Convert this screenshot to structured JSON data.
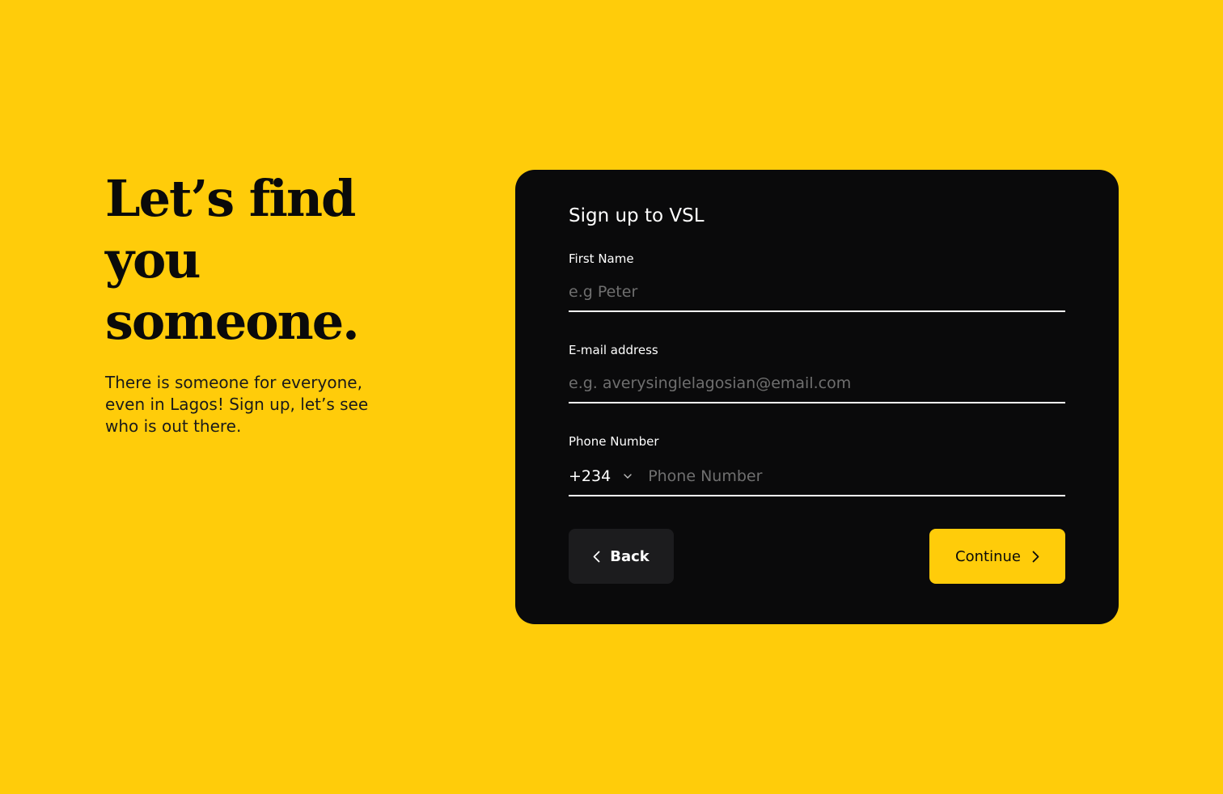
{
  "hero": {
    "title": "Let’s find you someone.",
    "subtitle": "There is someone for everyone, even in Lagos! Sign up, let’s see who is out there."
  },
  "form": {
    "title": "Sign up to VSL",
    "first_name": {
      "label": "First Name",
      "placeholder": "e.g Peter",
      "value": ""
    },
    "email": {
      "label": "E-mail address",
      "placeholder": "e.g. averysinglelagosian@email.com",
      "value": ""
    },
    "phone": {
      "label": "Phone Number",
      "country_code": "+234",
      "placeholder": "Phone Number",
      "value": ""
    },
    "back_label": "Back",
    "continue_label": "Continue"
  },
  "colors": {
    "background": "#FFCC0A",
    "card": "#0a0a0b",
    "accent": "#FFCC0A",
    "back_button": "#1c1c1e"
  },
  "icons": {
    "back": "chevron-left-icon",
    "continue": "chevron-right-icon",
    "country_dropdown": "chevron-down-icon"
  }
}
